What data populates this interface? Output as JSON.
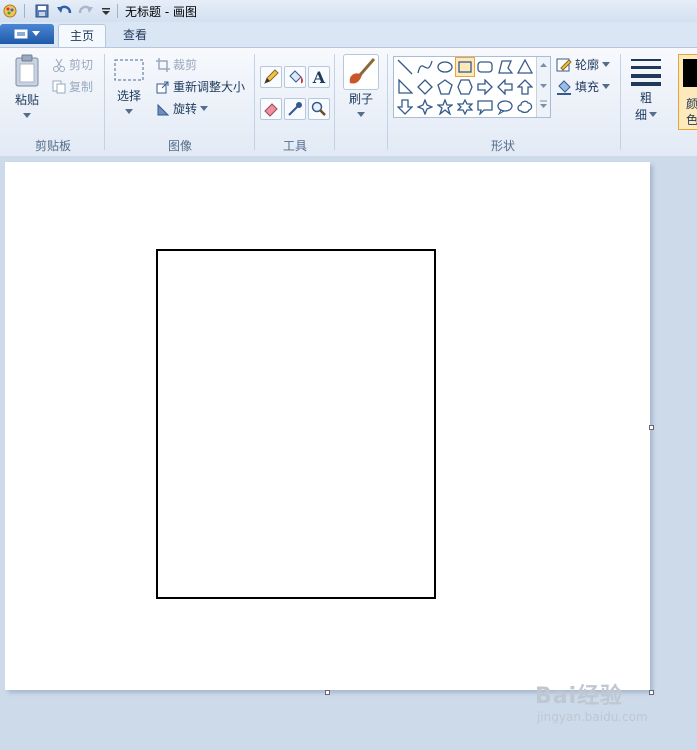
{
  "window": {
    "title": "无标题 - 画图"
  },
  "tabs": {
    "file": "",
    "home": "主页",
    "view": "查看"
  },
  "clipboard": {
    "paste": "粘贴",
    "cut": "剪切",
    "copy": "复制",
    "group": "剪贴板"
  },
  "image": {
    "select": "选择",
    "crop": "裁剪",
    "resize": "重新调整大小",
    "rotate": "旋转",
    "group": "图像"
  },
  "tools": {
    "group": "工具"
  },
  "brushes": {
    "label": "刷子"
  },
  "shapes": {
    "outline": "轮廓",
    "fill": "填充",
    "group": "形状"
  },
  "size": {
    "label1": "粗",
    "label2": "细"
  },
  "colors": {
    "label1": "颜",
    "label2": "色",
    "color1": "#000000",
    "accent": "#e8a33a"
  },
  "watermark": {
    "brand": "Bai经验",
    "url": "jingyan.baidu.com"
  }
}
